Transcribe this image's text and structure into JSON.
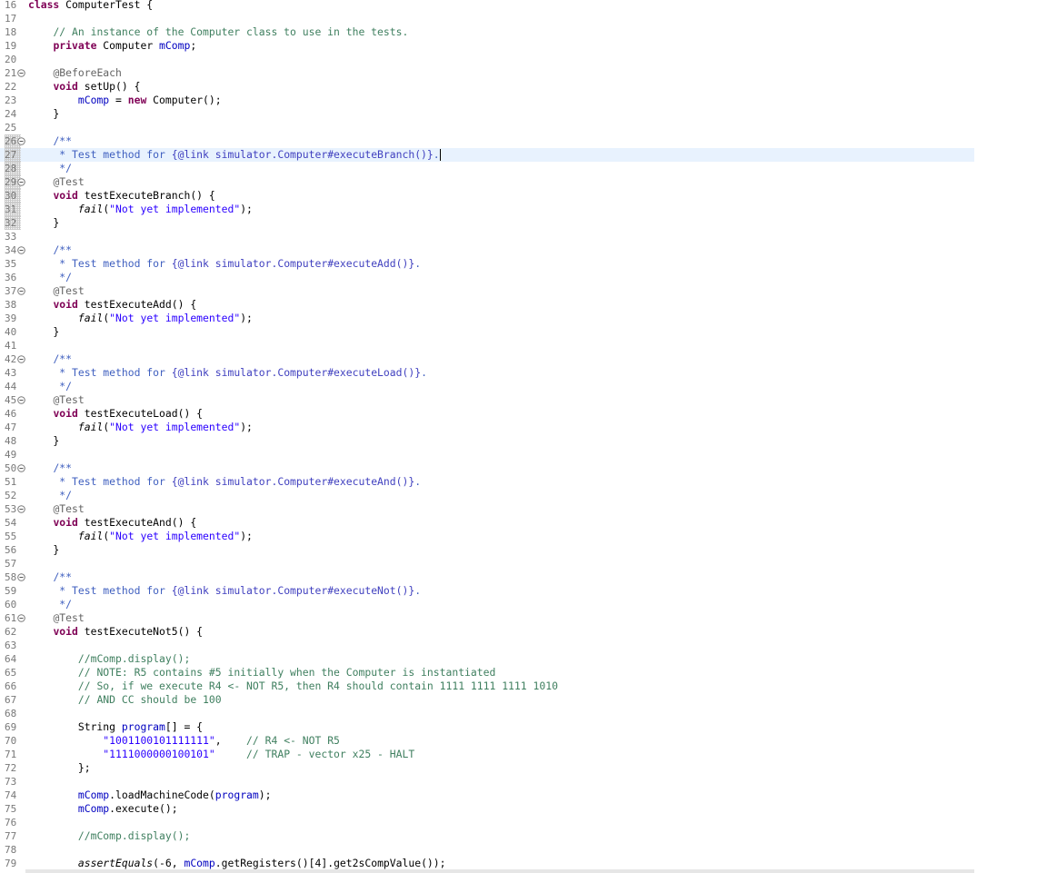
{
  "editor": {
    "current_line": 27,
    "lines": [
      {
        "n": "16",
        "fold": false,
        "tokens": [
          {
            "t": "kw",
            "v": "class"
          },
          {
            "t": "",
            "v": " ComputerTest {"
          }
        ]
      },
      {
        "n": "17",
        "fold": false,
        "tokens": []
      },
      {
        "n": "18",
        "fold": false,
        "tokens": [
          {
            "t": "",
            "v": "    "
          },
          {
            "t": "cm",
            "v": "// An instance of the Computer class to use in the tests."
          }
        ]
      },
      {
        "n": "19",
        "fold": false,
        "tokens": [
          {
            "t": "",
            "v": "    "
          },
          {
            "t": "kw",
            "v": "private"
          },
          {
            "t": "",
            "v": " Computer "
          },
          {
            "t": "fld",
            "v": "mComp"
          },
          {
            "t": "",
            "v": ";"
          }
        ]
      },
      {
        "n": "20",
        "fold": false,
        "tokens": []
      },
      {
        "n": "21",
        "fold": true,
        "tokens": [
          {
            "t": "",
            "v": "    "
          },
          {
            "t": "ann",
            "v": "@BeforeEach"
          }
        ]
      },
      {
        "n": "22",
        "fold": false,
        "tokens": [
          {
            "t": "",
            "v": "    "
          },
          {
            "t": "kw",
            "v": "void"
          },
          {
            "t": "",
            "v": " setUp() {"
          }
        ]
      },
      {
        "n": "23",
        "fold": false,
        "tokens": [
          {
            "t": "",
            "v": "        "
          },
          {
            "t": "fld",
            "v": "mComp"
          },
          {
            "t": "",
            "v": " = "
          },
          {
            "t": "kw",
            "v": "new"
          },
          {
            "t": "",
            "v": " Computer();"
          }
        ]
      },
      {
        "n": "24",
        "fold": false,
        "tokens": [
          {
            "t": "",
            "v": "    }"
          }
        ]
      },
      {
        "n": "25",
        "fold": false,
        "tokens": []
      },
      {
        "n": "26",
        "fold": true,
        "bp": true,
        "tokens": [
          {
            "t": "",
            "v": "    "
          },
          {
            "t": "jd",
            "v": "/**"
          }
        ]
      },
      {
        "n": "27",
        "fold": false,
        "bp": true,
        "tokens": [
          {
            "t": "",
            "v": "     "
          },
          {
            "t": "jd",
            "v": "* Test method for "
          },
          {
            "t": "jdt",
            "v": "{@link simulator.Computer#executeBranch()}"
          },
          {
            "t": "jd",
            "v": "."
          }
        ],
        "caret": true
      },
      {
        "n": "28",
        "fold": false,
        "bp": true,
        "tokens": [
          {
            "t": "",
            "v": "     "
          },
          {
            "t": "jd",
            "v": "*/"
          }
        ]
      },
      {
        "n": "29",
        "fold": true,
        "bp": true,
        "tokens": [
          {
            "t": "",
            "v": "    "
          },
          {
            "t": "ann",
            "v": "@Test"
          }
        ]
      },
      {
        "n": "30",
        "fold": false,
        "bp": true,
        "tokens": [
          {
            "t": "",
            "v": "    "
          },
          {
            "t": "kw",
            "v": "void"
          },
          {
            "t": "",
            "v": " testExecuteBranch() {"
          }
        ]
      },
      {
        "n": "31",
        "fold": false,
        "bp": true,
        "tokens": [
          {
            "t": "",
            "v": "        "
          },
          {
            "t": "it",
            "v": "fail"
          },
          {
            "t": "",
            "v": "("
          },
          {
            "t": "str",
            "v": "\"Not yet implemented\""
          },
          {
            "t": "",
            "v": ");"
          }
        ]
      },
      {
        "n": "32",
        "fold": false,
        "bp": true,
        "tokens": [
          {
            "t": "",
            "v": "    }"
          }
        ]
      },
      {
        "n": "33",
        "fold": false,
        "tokens": []
      },
      {
        "n": "34",
        "fold": true,
        "tokens": [
          {
            "t": "",
            "v": "    "
          },
          {
            "t": "jd",
            "v": "/**"
          }
        ]
      },
      {
        "n": "35",
        "fold": false,
        "tokens": [
          {
            "t": "",
            "v": "     "
          },
          {
            "t": "jd",
            "v": "* Test method for "
          },
          {
            "t": "jdt",
            "v": "{@link simulator.Computer#executeAdd()}"
          },
          {
            "t": "jd",
            "v": "."
          }
        ]
      },
      {
        "n": "36",
        "fold": false,
        "tokens": [
          {
            "t": "",
            "v": "     "
          },
          {
            "t": "jd",
            "v": "*/"
          }
        ]
      },
      {
        "n": "37",
        "fold": true,
        "tokens": [
          {
            "t": "",
            "v": "    "
          },
          {
            "t": "ann",
            "v": "@Test"
          }
        ]
      },
      {
        "n": "38",
        "fold": false,
        "tokens": [
          {
            "t": "",
            "v": "    "
          },
          {
            "t": "kw",
            "v": "void"
          },
          {
            "t": "",
            "v": " testExecuteAdd() {"
          }
        ]
      },
      {
        "n": "39",
        "fold": false,
        "tokens": [
          {
            "t": "",
            "v": "        "
          },
          {
            "t": "it",
            "v": "fail"
          },
          {
            "t": "",
            "v": "("
          },
          {
            "t": "str",
            "v": "\"Not yet implemented\""
          },
          {
            "t": "",
            "v": ");"
          }
        ]
      },
      {
        "n": "40",
        "fold": false,
        "tokens": [
          {
            "t": "",
            "v": "    }"
          }
        ]
      },
      {
        "n": "41",
        "fold": false,
        "tokens": []
      },
      {
        "n": "42",
        "fold": true,
        "tokens": [
          {
            "t": "",
            "v": "    "
          },
          {
            "t": "jd",
            "v": "/**"
          }
        ]
      },
      {
        "n": "43",
        "fold": false,
        "tokens": [
          {
            "t": "",
            "v": "     "
          },
          {
            "t": "jd",
            "v": "* Test method for "
          },
          {
            "t": "jdt",
            "v": "{@link simulator.Computer#executeLoad()}"
          },
          {
            "t": "jd",
            "v": "."
          }
        ]
      },
      {
        "n": "44",
        "fold": false,
        "tokens": [
          {
            "t": "",
            "v": "     "
          },
          {
            "t": "jd",
            "v": "*/"
          }
        ]
      },
      {
        "n": "45",
        "fold": true,
        "tokens": [
          {
            "t": "",
            "v": "    "
          },
          {
            "t": "ann",
            "v": "@Test"
          }
        ]
      },
      {
        "n": "46",
        "fold": false,
        "tokens": [
          {
            "t": "",
            "v": "    "
          },
          {
            "t": "kw",
            "v": "void"
          },
          {
            "t": "",
            "v": " testExecuteLoad() {"
          }
        ]
      },
      {
        "n": "47",
        "fold": false,
        "tokens": [
          {
            "t": "",
            "v": "        "
          },
          {
            "t": "it",
            "v": "fail"
          },
          {
            "t": "",
            "v": "("
          },
          {
            "t": "str",
            "v": "\"Not yet implemented\""
          },
          {
            "t": "",
            "v": ");"
          }
        ]
      },
      {
        "n": "48",
        "fold": false,
        "tokens": [
          {
            "t": "",
            "v": "    }"
          }
        ]
      },
      {
        "n": "49",
        "fold": false,
        "tokens": []
      },
      {
        "n": "50",
        "fold": true,
        "tokens": [
          {
            "t": "",
            "v": "    "
          },
          {
            "t": "jd",
            "v": "/**"
          }
        ]
      },
      {
        "n": "51",
        "fold": false,
        "tokens": [
          {
            "t": "",
            "v": "     "
          },
          {
            "t": "jd",
            "v": "* Test method for "
          },
          {
            "t": "jdt",
            "v": "{@link simulator.Computer#executeAnd()}"
          },
          {
            "t": "jd",
            "v": "."
          }
        ]
      },
      {
        "n": "52",
        "fold": false,
        "tokens": [
          {
            "t": "",
            "v": "     "
          },
          {
            "t": "jd",
            "v": "*/"
          }
        ]
      },
      {
        "n": "53",
        "fold": true,
        "tokens": [
          {
            "t": "",
            "v": "    "
          },
          {
            "t": "ann",
            "v": "@Test"
          }
        ]
      },
      {
        "n": "54",
        "fold": false,
        "tokens": [
          {
            "t": "",
            "v": "    "
          },
          {
            "t": "kw",
            "v": "void"
          },
          {
            "t": "",
            "v": " testExecuteAnd() {"
          }
        ]
      },
      {
        "n": "55",
        "fold": false,
        "tokens": [
          {
            "t": "",
            "v": "        "
          },
          {
            "t": "it",
            "v": "fail"
          },
          {
            "t": "",
            "v": "("
          },
          {
            "t": "str",
            "v": "\"Not yet implemented\""
          },
          {
            "t": "",
            "v": ");"
          }
        ]
      },
      {
        "n": "56",
        "fold": false,
        "tokens": [
          {
            "t": "",
            "v": "    }"
          }
        ]
      },
      {
        "n": "57",
        "fold": false,
        "tokens": []
      },
      {
        "n": "58",
        "fold": true,
        "tokens": [
          {
            "t": "",
            "v": "    "
          },
          {
            "t": "jd",
            "v": "/**"
          }
        ]
      },
      {
        "n": "59",
        "fold": false,
        "tokens": [
          {
            "t": "",
            "v": "     "
          },
          {
            "t": "jd",
            "v": "* Test method for "
          },
          {
            "t": "jdt",
            "v": "{@link simulator.Computer#executeNot()}"
          },
          {
            "t": "jd",
            "v": "."
          }
        ]
      },
      {
        "n": "60",
        "fold": false,
        "tokens": [
          {
            "t": "",
            "v": "     "
          },
          {
            "t": "jd",
            "v": "*/"
          }
        ]
      },
      {
        "n": "61",
        "fold": true,
        "tokens": [
          {
            "t": "",
            "v": "    "
          },
          {
            "t": "ann",
            "v": "@Test"
          }
        ]
      },
      {
        "n": "62",
        "fold": false,
        "tokens": [
          {
            "t": "",
            "v": "    "
          },
          {
            "t": "kw",
            "v": "void"
          },
          {
            "t": "",
            "v": " testExecuteNot5() {"
          }
        ]
      },
      {
        "n": "63",
        "fold": false,
        "tokens": []
      },
      {
        "n": "64",
        "fold": false,
        "tokens": [
          {
            "t": "",
            "v": "        "
          },
          {
            "t": "cm",
            "v": "//mComp.display();"
          }
        ]
      },
      {
        "n": "65",
        "fold": false,
        "tokens": [
          {
            "t": "",
            "v": "        "
          },
          {
            "t": "cm",
            "v": "// NOTE: R5 contains #5 initially when the Computer is instantiated"
          }
        ]
      },
      {
        "n": "66",
        "fold": false,
        "tokens": [
          {
            "t": "",
            "v": "        "
          },
          {
            "t": "cm",
            "v": "// So, if we execute R4 <- NOT R5, then R4 should contain 1111 1111 1111 1010"
          }
        ]
      },
      {
        "n": "67",
        "fold": false,
        "tokens": [
          {
            "t": "",
            "v": "        "
          },
          {
            "t": "cm",
            "v": "// AND CC should be 100"
          }
        ]
      },
      {
        "n": "68",
        "fold": false,
        "tokens": []
      },
      {
        "n": "69",
        "fold": false,
        "tokens": [
          {
            "t": "",
            "v": "        String "
          },
          {
            "t": "fld",
            "v": "program"
          },
          {
            "t": "",
            "v": "[] = {"
          }
        ]
      },
      {
        "n": "70",
        "fold": false,
        "tokens": [
          {
            "t": "",
            "v": "            "
          },
          {
            "t": "str",
            "v": "\"1001100101111111\""
          },
          {
            "t": "",
            "v": ",    "
          },
          {
            "t": "cm",
            "v": "// R4 <- NOT R5"
          }
        ]
      },
      {
        "n": "71",
        "fold": false,
        "tokens": [
          {
            "t": "",
            "v": "            "
          },
          {
            "t": "str",
            "v": "\"1111000000100101\""
          },
          {
            "t": "",
            "v": "     "
          },
          {
            "t": "cm",
            "v": "// TRAP - vector x25 - HALT"
          }
        ]
      },
      {
        "n": "72",
        "fold": false,
        "tokens": [
          {
            "t": "",
            "v": "        };"
          }
        ]
      },
      {
        "n": "73",
        "fold": false,
        "tokens": []
      },
      {
        "n": "74",
        "fold": false,
        "tokens": [
          {
            "t": "",
            "v": "        "
          },
          {
            "t": "fld",
            "v": "mComp"
          },
          {
            "t": "",
            "v": ".loadMachineCode("
          },
          {
            "t": "fld",
            "v": "program"
          },
          {
            "t": "",
            "v": ");"
          }
        ]
      },
      {
        "n": "75",
        "fold": false,
        "tokens": [
          {
            "t": "",
            "v": "        "
          },
          {
            "t": "fld",
            "v": "mComp"
          },
          {
            "t": "",
            "v": ".execute();"
          }
        ]
      },
      {
        "n": "76",
        "fold": false,
        "tokens": []
      },
      {
        "n": "77",
        "fold": false,
        "tokens": [
          {
            "t": "",
            "v": "        "
          },
          {
            "t": "cm",
            "v": "//mComp.display();"
          }
        ]
      },
      {
        "n": "78",
        "fold": false,
        "tokens": []
      },
      {
        "n": "79",
        "fold": false,
        "tokens": [
          {
            "t": "",
            "v": "        "
          },
          {
            "t": "it",
            "v": "assertEquals"
          },
          {
            "t": "",
            "v": "(-6, "
          },
          {
            "t": "fld",
            "v": "mComp"
          },
          {
            "t": "",
            "v": ".getRegisters()[4].get2sCompValue());"
          }
        ]
      }
    ]
  }
}
